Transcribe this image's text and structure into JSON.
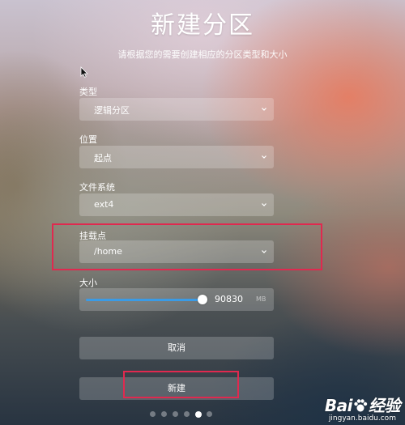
{
  "window": {
    "title": "新建分区",
    "subtitle": "请根据您的需要创建相应的分区类型和大小"
  },
  "form": {
    "type": {
      "label": "类型",
      "value": "逻辑分区"
    },
    "location": {
      "label": "位置",
      "value": "起点"
    },
    "filesystem": {
      "label": "文件系统",
      "value": "ext4"
    },
    "mountpoint": {
      "label": "挂载点",
      "value": "/home"
    },
    "size": {
      "label": "大小",
      "value": "90830",
      "unit": "MB",
      "slider_fraction": 1.0
    }
  },
  "buttons": {
    "cancel": "取消",
    "create": "新建"
  },
  "pagination": {
    "count": 6,
    "active_index": 4
  },
  "watermark": {
    "brand": "Bai",
    "brand_suffix": "经验",
    "site": "jingyan.baidu.com"
  },
  "colors": {
    "accent": "#3a9be6",
    "highlight": "#e0294f"
  },
  "icons": {
    "select_arrow": "chevron-down-icon",
    "cursor": "mouse-pointer-icon"
  }
}
